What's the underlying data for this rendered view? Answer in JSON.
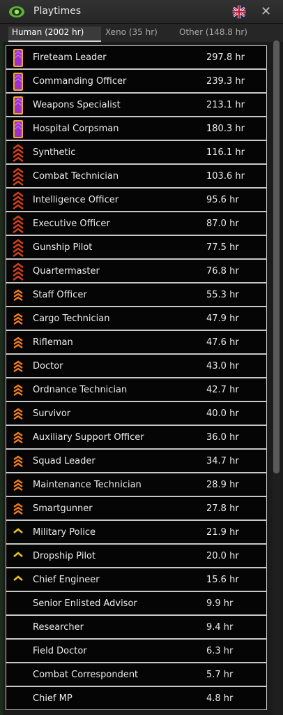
{
  "window": {
    "title": "Playtimes",
    "close_label": "✕"
  },
  "tabs": [
    {
      "label": "Human (2002 hr)",
      "active": true
    },
    {
      "label": "Xeno (35 hr)",
      "active": false
    },
    {
      "label": "Other (148.8 hr)",
      "active": false
    }
  ],
  "rank_colors": {
    "purple": "#9b2fd0",
    "red": "#d0401a",
    "orange": "#f07c20",
    "gold": "#f0c020",
    "trim": "#f0a820"
  },
  "roles": [
    {
      "name": "Fireteam Leader",
      "hours": "297.8 hr",
      "rank": "purple"
    },
    {
      "name": "Commanding Officer",
      "hours": "239.3 hr",
      "rank": "purple"
    },
    {
      "name": "Weapons Specialist",
      "hours": "213.1 hr",
      "rank": "purple"
    },
    {
      "name": "Hospital Corpsman",
      "hours": "180.3 hr",
      "rank": "purple"
    },
    {
      "name": "Synthetic",
      "hours": "116.1 hr",
      "rank": "red"
    },
    {
      "name": "Combat Technician",
      "hours": "103.6 hr",
      "rank": "red"
    },
    {
      "name": "Intelligence Officer",
      "hours": "95.6 hr",
      "rank": "red"
    },
    {
      "name": "Executive Officer",
      "hours": "87.0 hr",
      "rank": "red"
    },
    {
      "name": "Gunship Pilot",
      "hours": "77.5 hr",
      "rank": "red"
    },
    {
      "name": "Quartermaster",
      "hours": "76.8 hr",
      "rank": "red"
    },
    {
      "name": "Staff Officer",
      "hours": "55.3 hr",
      "rank": "orange"
    },
    {
      "name": "Cargo Technician",
      "hours": "47.9 hr",
      "rank": "orange"
    },
    {
      "name": "Rifleman",
      "hours": "47.6 hr",
      "rank": "orange"
    },
    {
      "name": "Doctor",
      "hours": "43.0 hr",
      "rank": "orange"
    },
    {
      "name": "Ordnance Technician",
      "hours": "42.7 hr",
      "rank": "orange"
    },
    {
      "name": "Survivor",
      "hours": "40.0 hr",
      "rank": "orange"
    },
    {
      "name": "Auxiliary Support Officer",
      "hours": "36.0 hr",
      "rank": "orange"
    },
    {
      "name": "Squad Leader",
      "hours": "34.7 hr",
      "rank": "orange"
    },
    {
      "name": "Maintenance Technician",
      "hours": "28.9 hr",
      "rank": "orange"
    },
    {
      "name": "Smartgunner",
      "hours": "27.8 hr",
      "rank": "orange"
    },
    {
      "name": "Military Police",
      "hours": "21.9 hr",
      "rank": "gold"
    },
    {
      "name": "Dropship Pilot",
      "hours": "20.0 hr",
      "rank": "gold"
    },
    {
      "name": "Chief Engineer",
      "hours": "15.6 hr",
      "rank": "gold"
    },
    {
      "name": "Senior Enlisted Advisor",
      "hours": "9.9 hr",
      "rank": "none"
    },
    {
      "name": "Researcher",
      "hours": "9.4 hr",
      "rank": "none"
    },
    {
      "name": "Field Doctor",
      "hours": "6.3 hr",
      "rank": "none"
    },
    {
      "name": "Combat Correspondent",
      "hours": "5.7 hr",
      "rank": "none"
    },
    {
      "name": "Chief MP",
      "hours": "4.8 hr",
      "rank": "none"
    }
  ]
}
